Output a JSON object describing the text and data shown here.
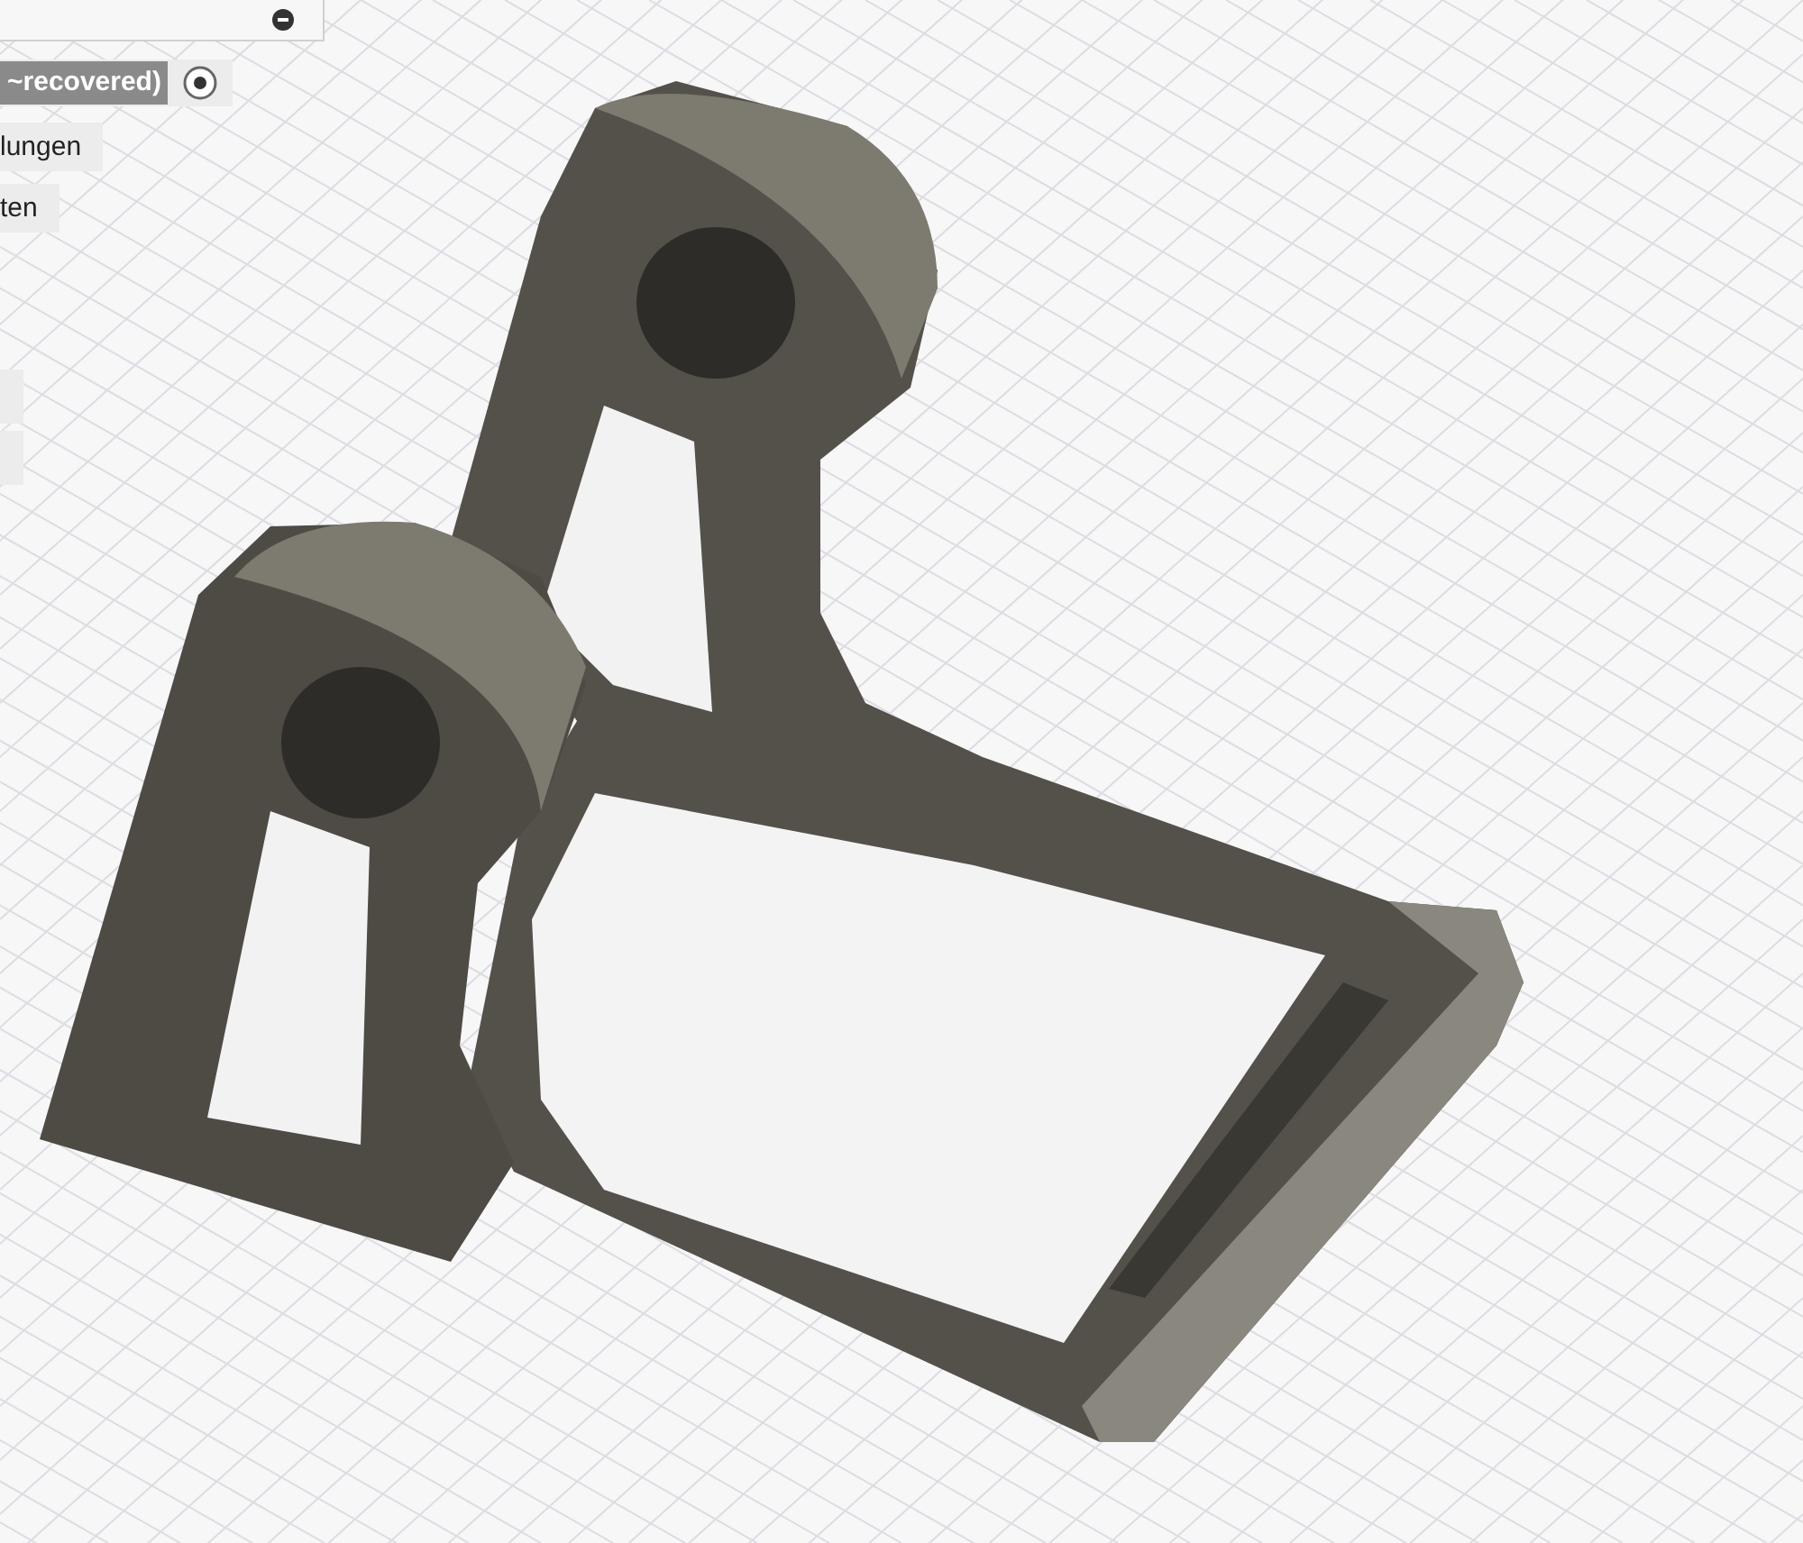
{
  "browser": {
    "document_label": "~recovered)",
    "items": [
      "lungen",
      "ten"
    ]
  }
}
